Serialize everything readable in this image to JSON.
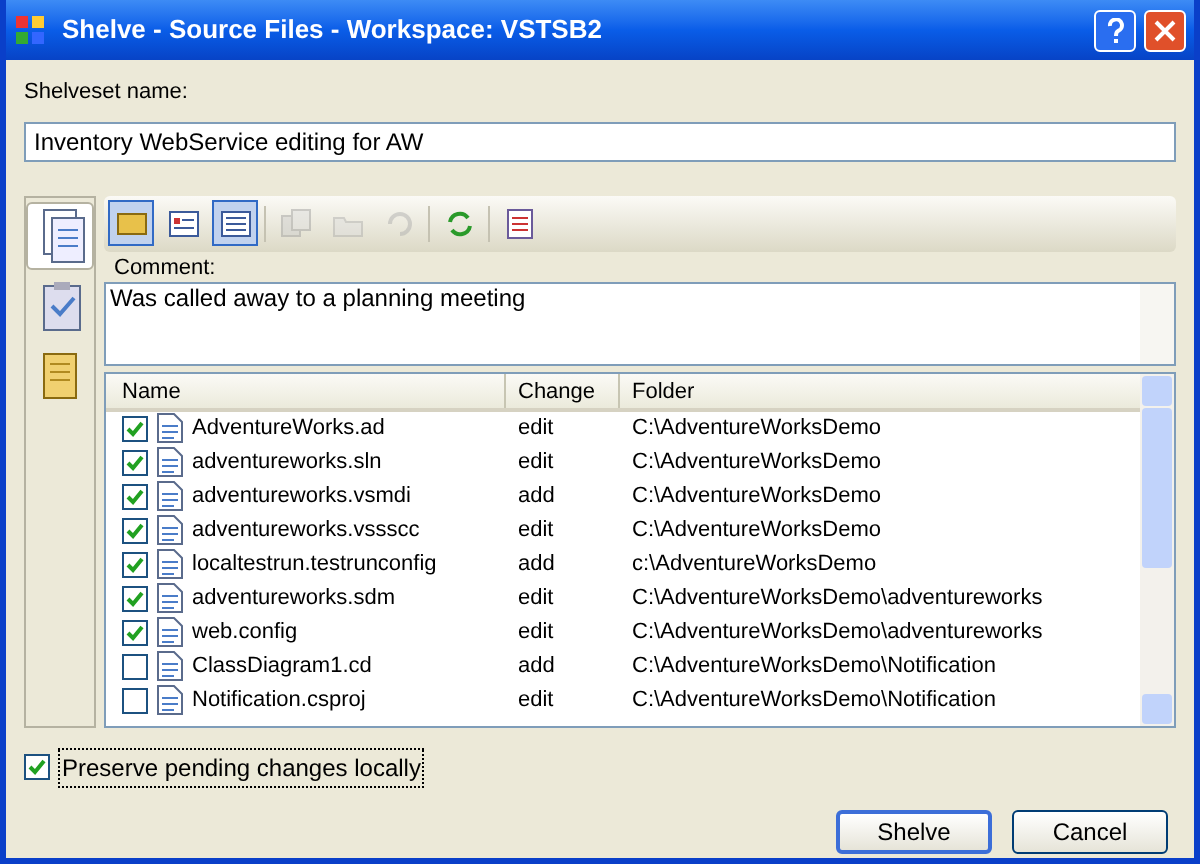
{
  "window": {
    "title": "Shelve - Source Files - Workspace: VSTSB2"
  },
  "shelveset": {
    "label": "Shelveset name:",
    "value": "Inventory WebService editing for AW"
  },
  "side_tabs": [
    {
      "selected": true
    },
    {
      "selected": false
    },
    {
      "selected": false
    }
  ],
  "toolbar": [
    {
      "pressed": true,
      "disabled": false
    },
    {
      "pressed": false,
      "disabled": false
    },
    {
      "pressed": true,
      "disabled": false
    },
    {
      "pressed": false,
      "disabled": true
    },
    {
      "pressed": false,
      "disabled": true
    },
    {
      "pressed": false,
      "disabled": true
    },
    {
      "pressed": false,
      "disabled": false
    },
    {
      "pressed": false,
      "disabled": false
    }
  ],
  "comment": {
    "label": "Comment:",
    "value": "Was called away to a planning meeting"
  },
  "table": {
    "columns": [
      "Name",
      "Change",
      "Folder"
    ],
    "rows": [
      {
        "checked": true,
        "name": "AdventureWorks.ad",
        "change": "edit",
        "folder": "C:\\AdventureWorksDemo"
      },
      {
        "checked": true,
        "name": "adventureworks.sln",
        "change": "edit",
        "folder": "C:\\AdventureWorksDemo"
      },
      {
        "checked": true,
        "name": "adventureworks.vsmdi",
        "change": "add",
        "folder": "C:\\AdventureWorksDemo"
      },
      {
        "checked": true,
        "name": "adventureworks.vssscc",
        "change": "edit",
        "folder": "C:\\AdventureWorksDemo"
      },
      {
        "checked": true,
        "name": "localtestrun.testrunconfig",
        "change": "add",
        "folder": "c:\\AdventureWorksDemo"
      },
      {
        "checked": true,
        "name": "adventureworks.sdm",
        "change": "edit",
        "folder": "C:\\AdventureWorksDemo\\adventureworks"
      },
      {
        "checked": true,
        "name": "web.config",
        "change": "edit",
        "folder": "C:\\AdventureWorksDemo\\adventureworks"
      },
      {
        "checked": false,
        "name": "ClassDiagram1.cd",
        "change": "add",
        "folder": "C:\\AdventureWorksDemo\\Notification"
      },
      {
        "checked": false,
        "name": "Notification.csproj",
        "change": "edit",
        "folder": "C:\\AdventureWorksDemo\\Notification"
      }
    ]
  },
  "preserve": {
    "label": "Preserve pending changes locally",
    "checked": true
  },
  "buttons": [
    {
      "label": "Shelve",
      "default": true
    },
    {
      "label": "Cancel",
      "default": false
    }
  ]
}
